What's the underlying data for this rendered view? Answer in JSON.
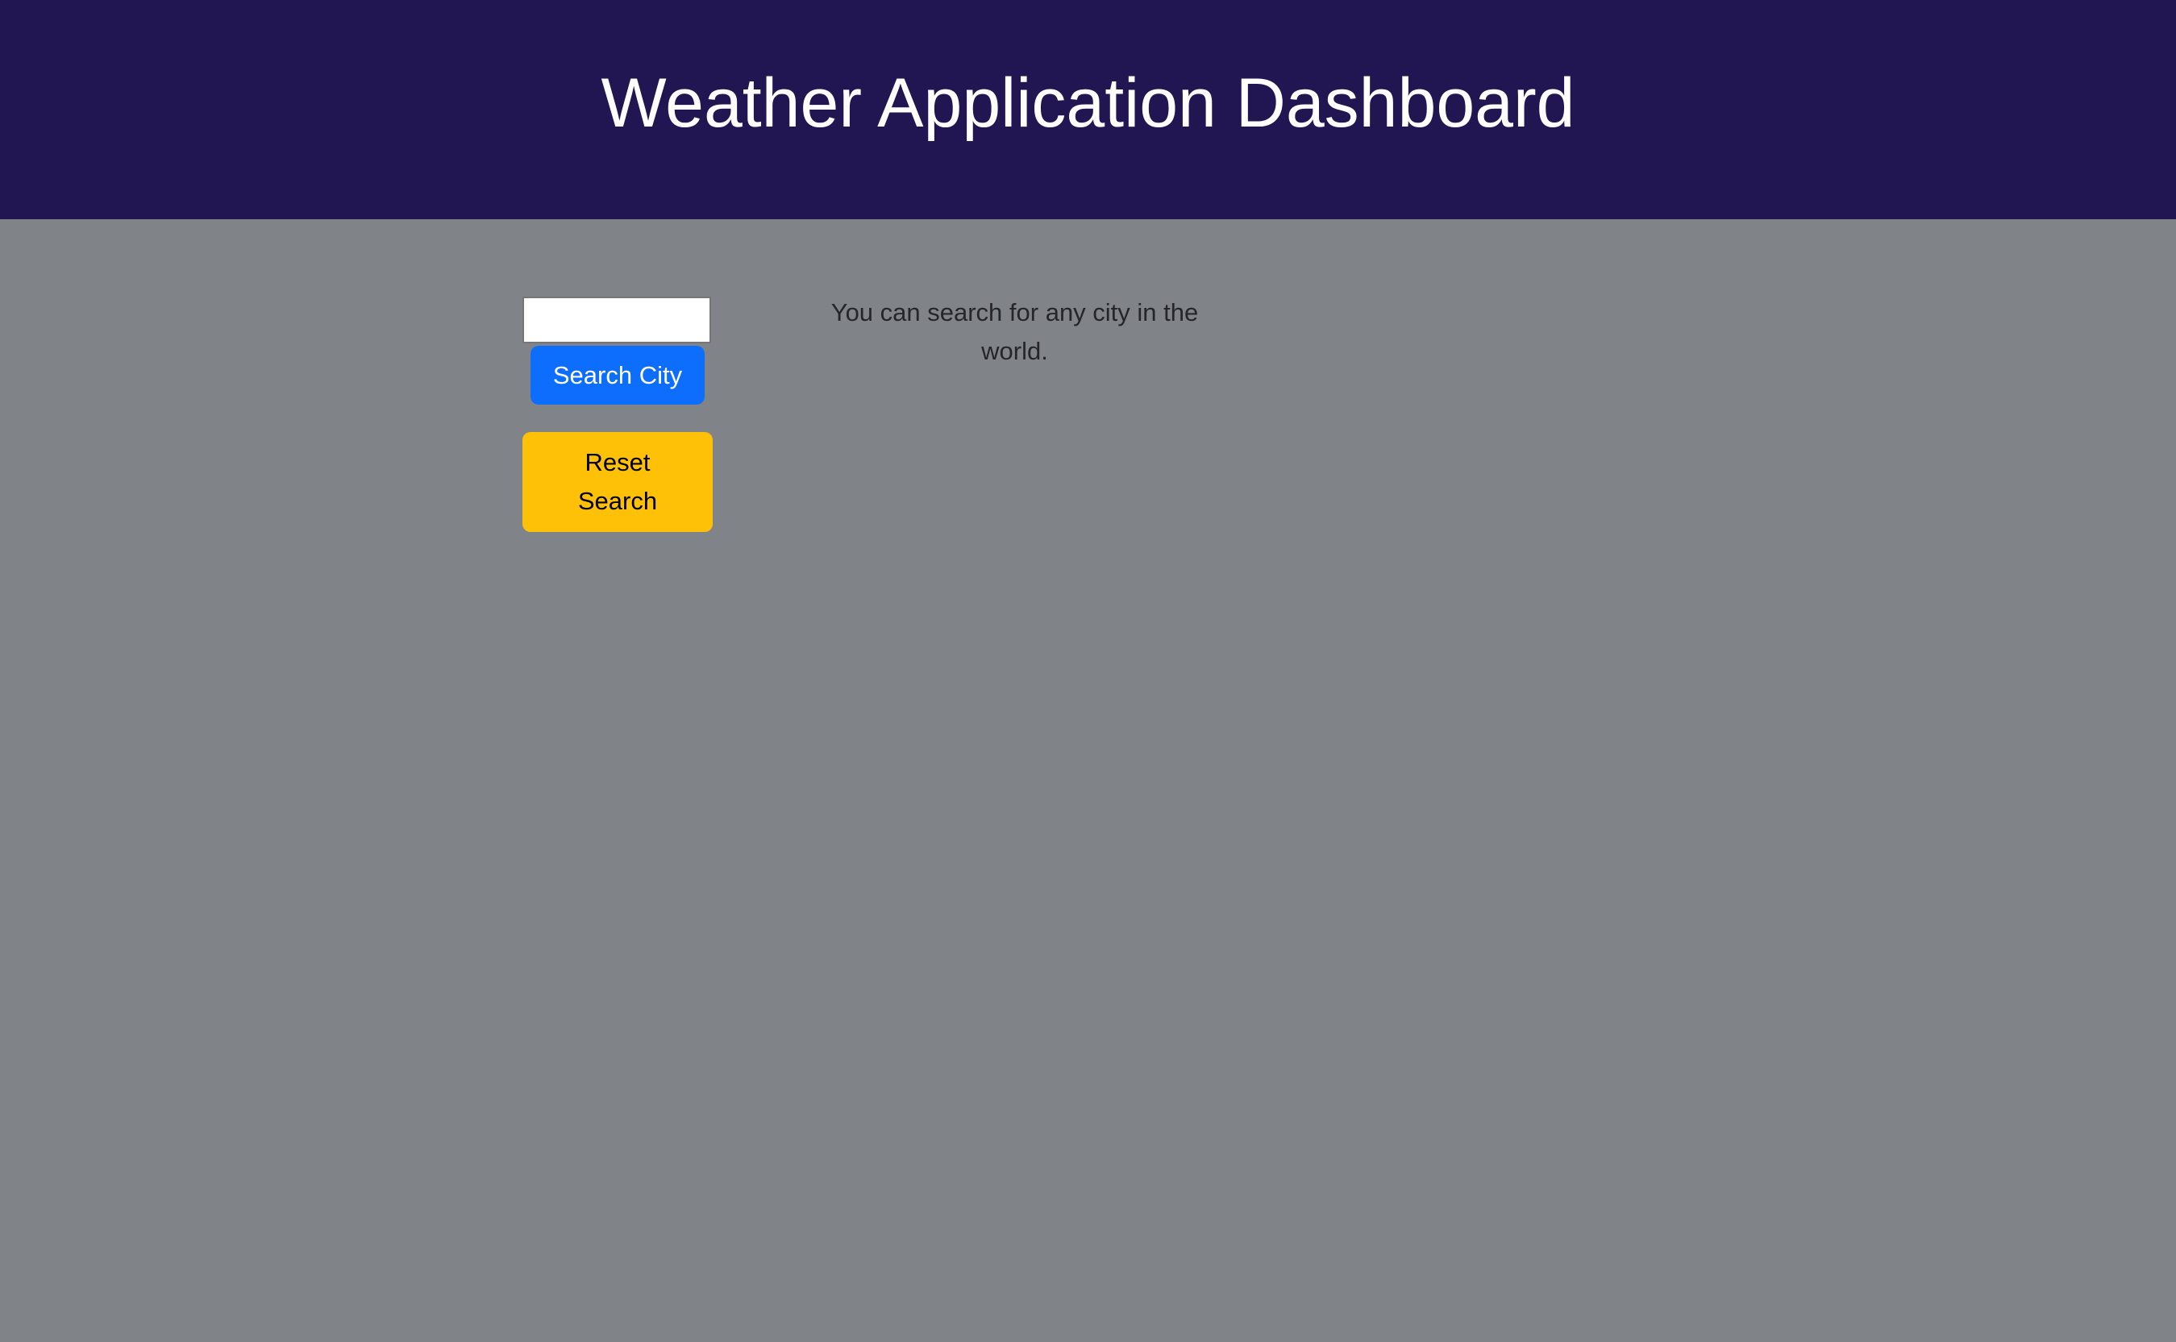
{
  "header": {
    "title": "Weather Application Dashboard"
  },
  "search": {
    "input_value": "",
    "placeholder": "",
    "search_button_label": "Search City",
    "reset_button_label": "Reset Search"
  },
  "main": {
    "hint_text": "You can search for any city in the world."
  },
  "colors": {
    "header_background": "#211651",
    "page_background": "#808387",
    "search_button": "#0d6efd",
    "reset_button": "#ffc107"
  }
}
